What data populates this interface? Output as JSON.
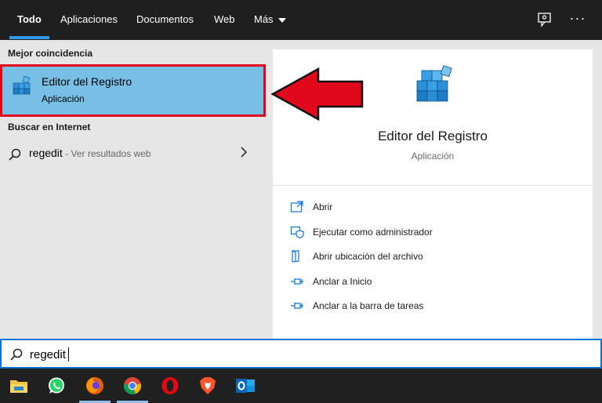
{
  "tabs": [
    {
      "label": "Todo",
      "active": true
    },
    {
      "label": "Aplicaciones"
    },
    {
      "label": "Documentos"
    },
    {
      "label": "Web"
    },
    {
      "label": "Más"
    }
  ],
  "top_icons": [
    "feedback-icon",
    "more-options-icon"
  ],
  "more_symbol": "···",
  "results": {
    "best_match_heading": "Mejor coincidencia",
    "best_match": {
      "title": "Editor del Registro",
      "subtitle": "Aplicación",
      "icon": "registry-editor-icon"
    },
    "web_heading": "Buscar en Internet",
    "web_result": {
      "query": "regedit",
      "hint": " - Ver resultados web"
    }
  },
  "detail": {
    "title": "Editor del Registro",
    "subtitle": "Aplicación",
    "actions": [
      {
        "label": "Abrir",
        "icon": "open-icon"
      },
      {
        "label": "Ejecutar como administrador",
        "icon": "run-as-admin-icon"
      },
      {
        "label": "Abrir ubicación del archivo",
        "icon": "file-location-icon"
      },
      {
        "label": "Anclar a Inicio",
        "icon": "pin-icon"
      },
      {
        "label": "Anclar a la barra de tareas",
        "icon": "pin-icon"
      }
    ]
  },
  "search": {
    "value": "regedit"
  },
  "taskbar": {
    "apps": [
      "file-explorer-icon",
      "whatsapp-icon",
      "firefox-icon",
      "chrome-icon",
      "opera-icon",
      "brave-icon",
      "outlook-icon"
    ]
  },
  "colors": {
    "accent": "#0a74d8",
    "selection": "#78bfe6",
    "highlight_border": "#e2081b",
    "arrow": "#e2081b"
  }
}
